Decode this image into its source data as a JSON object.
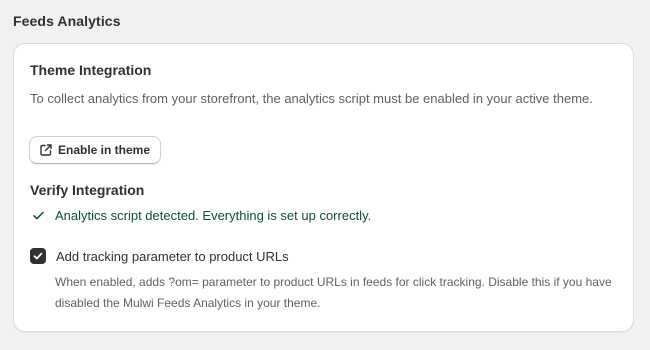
{
  "page": {
    "title": "Feeds Analytics"
  },
  "theme_integration": {
    "heading": "Theme Integration",
    "description": "To collect analytics from your storefront, the analytics script must be enabled in your active theme.",
    "button_label": "Enable in theme",
    "button_icon": "external-link-icon"
  },
  "verify_integration": {
    "heading": "Verify Integration",
    "status_text": "Analytics script detected. Everything is set up correctly.",
    "status_icon": "checkmark-icon",
    "status_color": "#0c5132"
  },
  "tracking_option": {
    "checked": true,
    "label": "Add tracking parameter to product URLs",
    "help_text": "When enabled, adds ?om= parameter to product URLs in feeds for click tracking. Disable this if you have disabled the Mulwi Feeds Analytics in your theme."
  },
  "colors": {
    "background": "#f1f1f1",
    "card": "#ffffff",
    "text": "#303030",
    "subdued_text": "#616161",
    "success": "#0c5132",
    "checkbox_fill": "#303030"
  }
}
